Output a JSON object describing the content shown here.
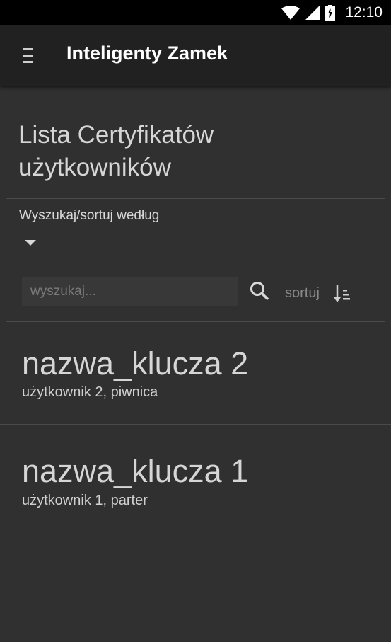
{
  "status_bar": {
    "time": "12:10"
  },
  "app_bar": {
    "title": "Inteligenty Zamek",
    "menu_icon": "hamburger-icon"
  },
  "page": {
    "title": "Lista Certyfikatów użytkowników",
    "filter_label": "Wyszukaj/sortuj według"
  },
  "search": {
    "placeholder": "wyszukaj...",
    "value": "",
    "sort_label": "sortuj"
  },
  "items": [
    {
      "name": "nazwa_klucza 2",
      "subtitle": "użytkownik 2, piwnica"
    },
    {
      "name": "nazwa_klucza 1",
      "subtitle": "użytkownik 1, parter"
    }
  ],
  "colors": {
    "background": "#303030",
    "app_bar": "#212121",
    "status_bar": "#000000"
  }
}
